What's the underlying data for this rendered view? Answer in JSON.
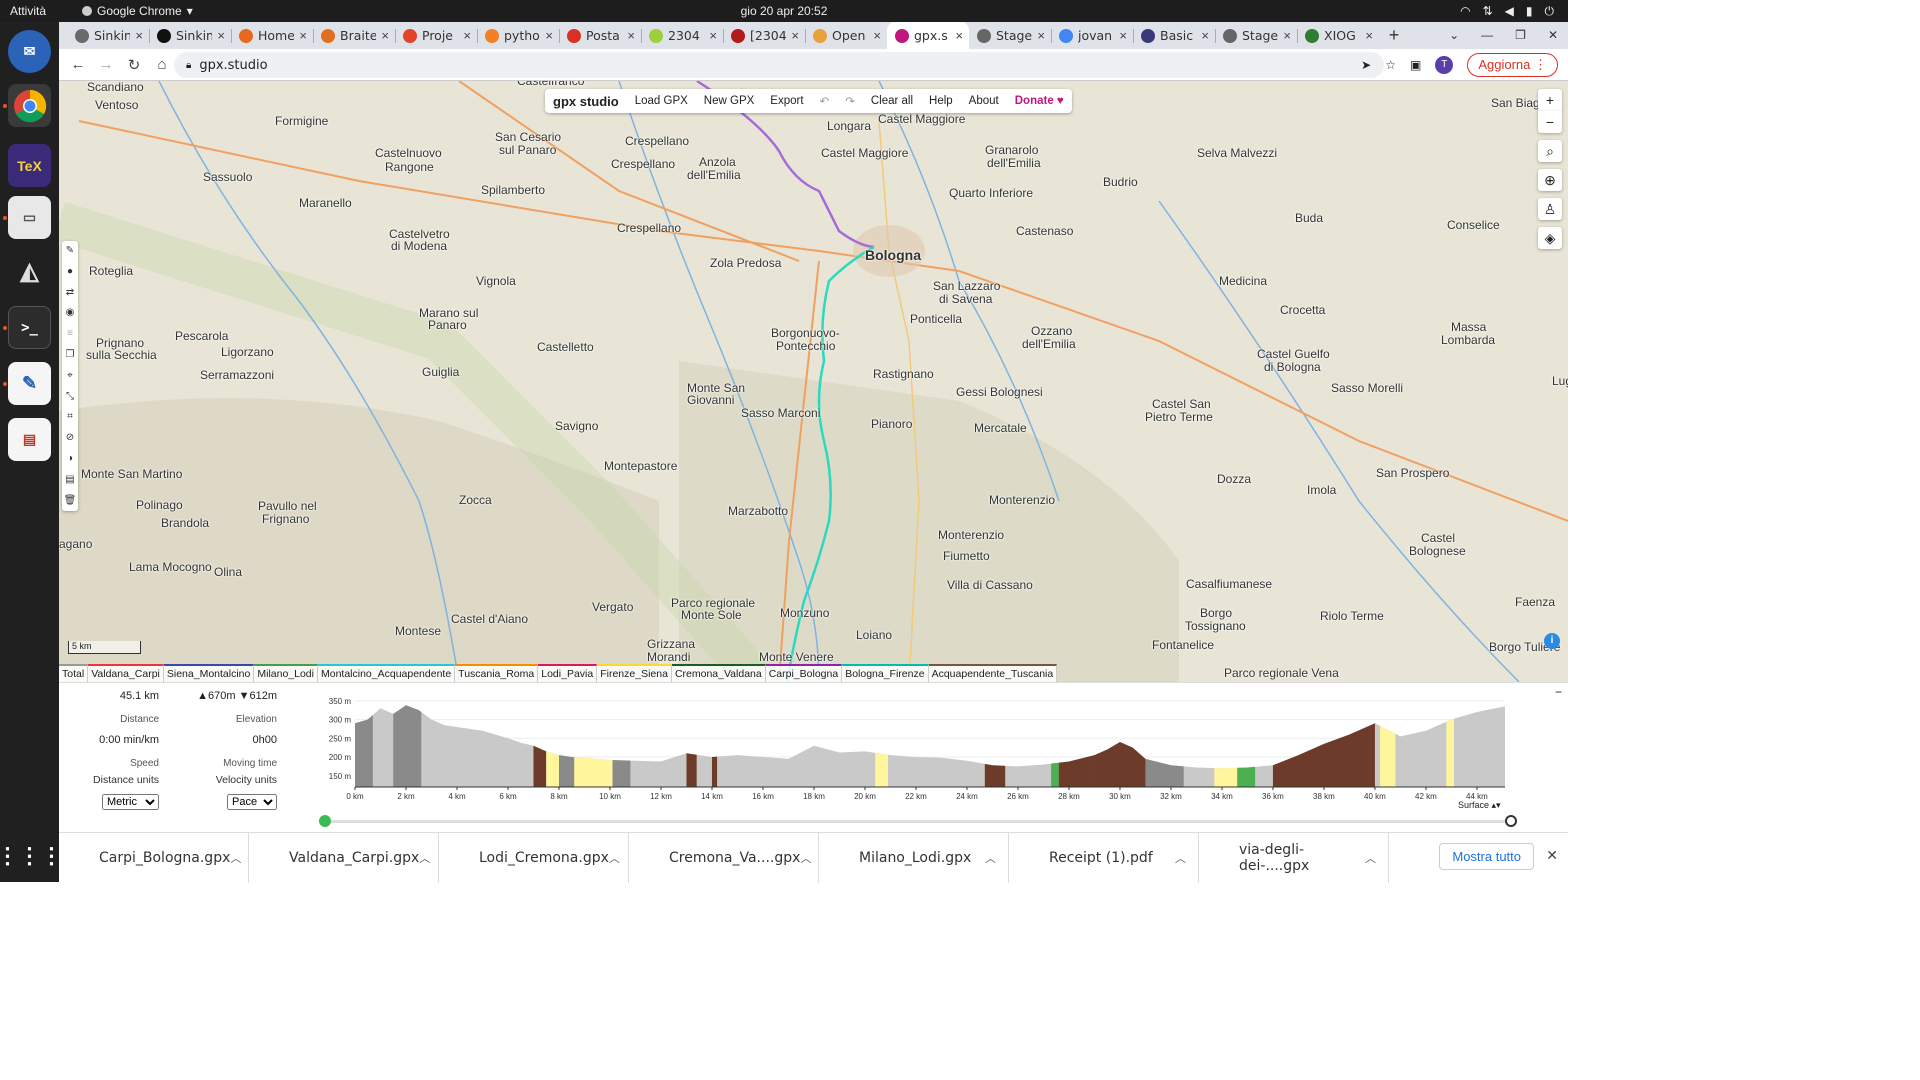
{
  "system": {
    "activities": "Attività",
    "app_name": "Google Chrome",
    "clock": "gio 20 apr  20:52"
  },
  "tabs": [
    {
      "label": "Sinkin",
      "color": "#6a6a6a"
    },
    {
      "label": "Sinkin",
      "color": "#111111"
    },
    {
      "label": "Home",
      "color": "#e66a1d"
    },
    {
      "label": "Braite",
      "color": "#e07020"
    },
    {
      "label": "Proje",
      "color": "#e24329"
    },
    {
      "label": "pytho",
      "color": "#f48024"
    },
    {
      "label": "Posta",
      "color": "#d93025"
    },
    {
      "label": "2304",
      "color": "#9ad13b"
    },
    {
      "label": "[2304",
      "color": "#b31b1b"
    },
    {
      "label": "Open",
      "color": "#e8a23a"
    },
    {
      "label": "gpx.s",
      "color": "#c0177f"
    },
    {
      "label": "Stage",
      "color": "#666666"
    },
    {
      "label": "jovan",
      "color": "#4285f4"
    },
    {
      "label": "Basic",
      "color": "#3a3a7a"
    },
    {
      "label": "Stage",
      "color": "#666666"
    },
    {
      "label": "XIOG",
      "color": "#2f7d32"
    }
  ],
  "address": {
    "url": "gpx.studio",
    "update_label": "Aggiorna",
    "avatar": "T"
  },
  "toolbar": {
    "logo": "gpx studio",
    "load": "Load GPX",
    "new": "New GPX",
    "export": "Export",
    "clear": "Clear all",
    "help": "Help",
    "about": "About",
    "donate": "Donate ♥"
  },
  "map": {
    "scale": "5 km",
    "places": [
      {
        "t": "Scandiano",
        "x": 28,
        "y": 0
      },
      {
        "t": "Ventoso",
        "x": 36,
        "y": 18
      },
      {
        "t": "Formigine",
        "x": 216,
        "y": 34
      },
      {
        "t": "Sassuolo",
        "x": 144,
        "y": 90
      },
      {
        "t": "Maranello",
        "x": 240,
        "y": 116
      },
      {
        "t": "Castelnuovo",
        "x": 316,
        "y": 66
      },
      {
        "t": "Rangone",
        "x": 326,
        "y": 80
      },
      {
        "t": "San Cesario",
        "x": 436,
        "y": 50
      },
      {
        "t": "sul Panaro",
        "x": 440,
        "y": 63
      },
      {
        "t": "Spilamberto",
        "x": 422,
        "y": 103
      },
      {
        "t": "Castelfranco",
        "x": 458,
        "y": -6
      },
      {
        "t": "Crespellano",
        "x": 566,
        "y": 54
      },
      {
        "t": "Crespellano",
        "x": 552,
        "y": 77
      },
      {
        "t": "Anzola",
        "x": 640,
        "y": 75
      },
      {
        "t": "dell'Emilia",
        "x": 628,
        "y": 88
      },
      {
        "t": "Crespellano",
        "x": 558,
        "y": 141
      },
      {
        "t": "Castelvetro",
        "x": 330,
        "y": 147
      },
      {
        "t": "di Modena",
        "x": 332,
        "y": 159
      },
      {
        "t": "Roteglia",
        "x": 30,
        "y": 184
      },
      {
        "t": "Vignola",
        "x": 417,
        "y": 194
      },
      {
        "t": "Zola Predosa",
        "x": 651,
        "y": 176
      },
      {
        "t": "Marano sul",
        "x": 360,
        "y": 226
      },
      {
        "t": "Panaro",
        "x": 369,
        "y": 238
      },
      {
        "t": "Castelletto",
        "x": 478,
        "y": 260
      },
      {
        "t": "Prignano",
        "x": 37,
        "y": 256
      },
      {
        "t": "sulla Secchia",
        "x": 27,
        "y": 268
      },
      {
        "t": "Pescarola",
        "x": 116,
        "y": 249
      },
      {
        "t": "Ligorzano",
        "x": 162,
        "y": 265
      },
      {
        "t": "Serramazzoni",
        "x": 141,
        "y": 288
      },
      {
        "t": "Guiglia",
        "x": 363,
        "y": 285
      },
      {
        "t": "Borgonuovo-",
        "x": 712,
        "y": 246
      },
      {
        "t": "Pontecchio",
        "x": 717,
        "y": 259
      },
      {
        "t": "Monte San",
        "x": 628,
        "y": 301
      },
      {
        "t": "Giovanni",
        "x": 628,
        "y": 313
      },
      {
        "t": "Sasso Marconi",
        "x": 682,
        "y": 326
      },
      {
        "t": "Savigno",
        "x": 496,
        "y": 339
      },
      {
        "t": "Rastignano",
        "x": 814,
        "y": 287
      },
      {
        "t": "Pianoro",
        "x": 812,
        "y": 337
      },
      {
        "t": "Longara",
        "x": 768,
        "y": 39
      },
      {
        "t": "Castel Maggiore",
        "x": 819,
        "y": 32
      },
      {
        "t": "Castel Maggiore",
        "x": 762,
        "y": 66
      },
      {
        "t": "Granarolo",
        "x": 926,
        "y": 63
      },
      {
        "t": "dell'Emilia",
        "x": 928,
        "y": 76
      },
      {
        "t": "Quarto Inferiore",
        "x": 890,
        "y": 106
      },
      {
        "t": "Castenaso",
        "x": 957,
        "y": 144
      },
      {
        "t": "San Lazzaro",
        "x": 874,
        "y": 199
      },
      {
        "t": "di Savena",
        "x": 880,
        "y": 212
      },
      {
        "t": "Ponticella",
        "x": 851,
        "y": 232
      },
      {
        "t": "Ozzano",
        "x": 972,
        "y": 244
      },
      {
        "t": "dell'Emilia",
        "x": 963,
        "y": 257
      },
      {
        "t": "Gessi Bolognesi",
        "x": 897,
        "y": 305
      },
      {
        "t": "Mercatale",
        "x": 915,
        "y": 341
      },
      {
        "t": "Budrio",
        "x": 1044,
        "y": 95
      },
      {
        "t": "Selva Malvezzi",
        "x": 1138,
        "y": 66
      },
      {
        "t": "Buda",
        "x": 1236,
        "y": 131
      },
      {
        "t": "Medicina",
        "x": 1160,
        "y": 194
      },
      {
        "t": "Conselice",
        "x": 1388,
        "y": 138
      },
      {
        "t": "Crocetta",
        "x": 1221,
        "y": 223
      },
      {
        "t": "Massa",
        "x": 1392,
        "y": 240
      },
      {
        "t": "Lombarda",
        "x": 1382,
        "y": 253
      },
      {
        "t": "Castel Guelfo",
        "x": 1198,
        "y": 267
      },
      {
        "t": "di Bologna",
        "x": 1205,
        "y": 280
      },
      {
        "t": "Sasso Morelli",
        "x": 1272,
        "y": 301
      },
      {
        "t": "Castel San",
        "x": 1093,
        "y": 317
      },
      {
        "t": "Pietro Terme",
        "x": 1086,
        "y": 330
      },
      {
        "t": "San Prospero",
        "x": 1317,
        "y": 386
      },
      {
        "t": "Dozza",
        "x": 1158,
        "y": 392
      },
      {
        "t": "Imola",
        "x": 1248,
        "y": 403
      },
      {
        "t": "Monterenzio",
        "x": 930,
        "y": 413
      },
      {
        "t": "Monterenzio",
        "x": 879,
        "y": 448
      },
      {
        "t": "Fiumetto",
        "x": 884,
        "y": 469
      },
      {
        "t": "Villa di Cassano",
        "x": 888,
        "y": 498
      },
      {
        "t": "Casalfiumanese",
        "x": 1127,
        "y": 497
      },
      {
        "t": "Castel",
        "x": 1362,
        "y": 451
      },
      {
        "t": "Bolognese",
        "x": 1350,
        "y": 464
      },
      {
        "t": "Borgo",
        "x": 1141,
        "y": 526
      },
      {
        "t": "Tossignano",
        "x": 1126,
        "y": 539
      },
      {
        "t": "Riolo Terme",
        "x": 1261,
        "y": 529
      },
      {
        "t": "Fontanelice",
        "x": 1093,
        "y": 558
      },
      {
        "t": "Faenza",
        "x": 1456,
        "y": 515
      },
      {
        "t": "Borgo Tulière",
        "x": 1430,
        "y": 560
      },
      {
        "t": "Parco regionale Vena",
        "x": 1165,
        "y": 586
      },
      {
        "t": "Polinago",
        "x": 77,
        "y": 418
      },
      {
        "t": "Brandola",
        "x": 102,
        "y": 436
      },
      {
        "t": "Pavullo nel",
        "x": 199,
        "y": 419
      },
      {
        "t": "Frignano",
        "x": 203,
        "y": 432
      },
      {
        "t": "Monte San Martino",
        "x": 22,
        "y": 387
      },
      {
        "t": "Montepastore",
        "x": 545,
        "y": 379
      },
      {
        "t": "Zocca",
        "x": 400,
        "y": 413
      },
      {
        "t": "Marzabotto",
        "x": 669,
        "y": 424
      },
      {
        "t": "Lama Mocogno",
        "x": 70,
        "y": 480
      },
      {
        "t": "Olina",
        "x": 155,
        "y": 485
      },
      {
        "t": "Vergato",
        "x": 533,
        "y": 520
      },
      {
        "t": "Castel d'Aiano",
        "x": 392,
        "y": 532
      },
      {
        "t": "Montese",
        "x": 336,
        "y": 544
      },
      {
        "t": "Parco regionale",
        "x": 612,
        "y": 516
      },
      {
        "t": "Monte Sole",
        "x": 622,
        "y": 528
      },
      {
        "t": "Monzuno",
        "x": 721,
        "y": 526
      },
      {
        "t": "Loiano",
        "x": 797,
        "y": 548
      },
      {
        "t": "Grizzana",
        "x": 588,
        "y": 557
      },
      {
        "t": "Morandi",
        "x": 588,
        "y": 570
      },
      {
        "t": "Monte Venere",
        "x": 700,
        "y": 570
      },
      {
        "t": "agano",
        "x": 0,
        "y": 457
      },
      {
        "t": "San Biagio",
        "x": 1432,
        "y": 16
      },
      {
        "t": "Lug",
        "x": 1493,
        "y": 294
      }
    ],
    "big_places": [
      {
        "t": "Bologna",
        "x": 806,
        "y": 168
      }
    ],
    "mid_places": [
      {
        "t": "Sasso Marconi",
        "x": 0,
        "y": 0
      }
    ],
    "legend": [
      {
        "t": "Total",
        "c": "#999999"
      },
      {
        "t": "Valdana_Carpi",
        "c": "#e53935"
      },
      {
        "t": "Siena_Montalcino",
        "c": "#3949ab"
      },
      {
        "t": "Milano_Lodi",
        "c": "#43a047"
      },
      {
        "t": "Montalcino_Acquapendente",
        "c": "#26c6da"
      },
      {
        "t": "Tuscania_Roma",
        "c": "#fb8c00"
      },
      {
        "t": "Lodi_Pavia",
        "c": "#d81b60"
      },
      {
        "t": "Firenze_Siena",
        "c": "#fdd835"
      },
      {
        "t": "Cremona_Valdana",
        "c": "#1b5e20"
      },
      {
        "t": "Carpi_Bologna",
        "c": "#8e24aa"
      },
      {
        "t": "Bologna_Firenze",
        "c": "#00bfa5"
      },
      {
        "t": "Acquapendente_Tuscania",
        "c": "#795548"
      }
    ]
  },
  "stats": {
    "distance": "45.1 km",
    "distance_label": "Distance",
    "elevation": "▲670m ▼612m",
    "elevation_label": "Elevation",
    "pace": "0:00 min/km",
    "speed_label": "Speed",
    "moving": "0h00",
    "moving_label": "Moving time",
    "distance_units_label": "Distance units",
    "velocity_units_label": "Velocity units",
    "distance_unit": "Metric",
    "velocity_unit": "Pace",
    "surface_label": "Surface"
  },
  "chart_data": {
    "type": "area",
    "title": "",
    "xlabel": "",
    "ylabel": "",
    "x_ticks": [
      "0 km",
      "2 km",
      "4 km",
      "6 km",
      "8 km",
      "10 km",
      "12 km",
      "14 km",
      "16 km",
      "18 km",
      "20 km",
      "22 km",
      "24 km",
      "26 km",
      "28 km",
      "30 km",
      "32 km",
      "34 km",
      "36 km",
      "38 km",
      "40 km",
      "42 km",
      "44 km"
    ],
    "y_ticks": [
      "150 m",
      "200 m",
      "250 m",
      "300 m",
      "350 m"
    ],
    "xlim": [
      0,
      45.1
    ],
    "ylim": [
      120,
      360
    ],
    "x": [
      0,
      0.5,
      1,
      1.5,
      2,
      2.5,
      3,
      3.5,
      4,
      4.5,
      5,
      5.5,
      6,
      6.5,
      7,
      7.5,
      8,
      8.5,
      9,
      9.5,
      10,
      11,
      12,
      13,
      14,
      15,
      16,
      17,
      18,
      19,
      20,
      21,
      22,
      23,
      24,
      25,
      26,
      27,
      28,
      29,
      29.5,
      30,
      30.5,
      31,
      32,
      33,
      34,
      35,
      36,
      37,
      38,
      39,
      40,
      41,
      42,
      43,
      44,
      45.1
    ],
    "y": [
      290,
      300,
      330,
      315,
      338,
      325,
      300,
      285,
      280,
      275,
      270,
      260,
      250,
      238,
      230,
      215,
      205,
      200,
      198,
      195,
      192,
      190,
      188,
      210,
      200,
      205,
      200,
      195,
      230,
      212,
      215,
      205,
      200,
      198,
      190,
      178,
      175,
      180,
      188,
      205,
      220,
      240,
      225,
      195,
      178,
      172,
      170,
      172,
      178,
      205,
      235,
      260,
      290,
      255,
      270,
      300,
      320,
      335,
      338
    ],
    "surface_colors": {
      "paved": "#8a8a8a",
      "unpaved": "#c9c9c9",
      "gravel": "#fff59d",
      "dirt": "#6d3b2a",
      "grass": "#4caf50"
    }
  },
  "downloads": [
    {
      "t": "Carpi_Bologna.gpx"
    },
    {
      "t": "Valdana_Carpi.gpx"
    },
    {
      "t": "Lodi_Cremona.gpx"
    },
    {
      "t": "Cremona_Va....gpx"
    },
    {
      "t": "Milano_Lodi.gpx"
    },
    {
      "t": "Receipt (1).pdf"
    },
    {
      "t": "via-degli-dei-....gpx"
    }
  ],
  "downloads_show_all": "Mostra tutto"
}
